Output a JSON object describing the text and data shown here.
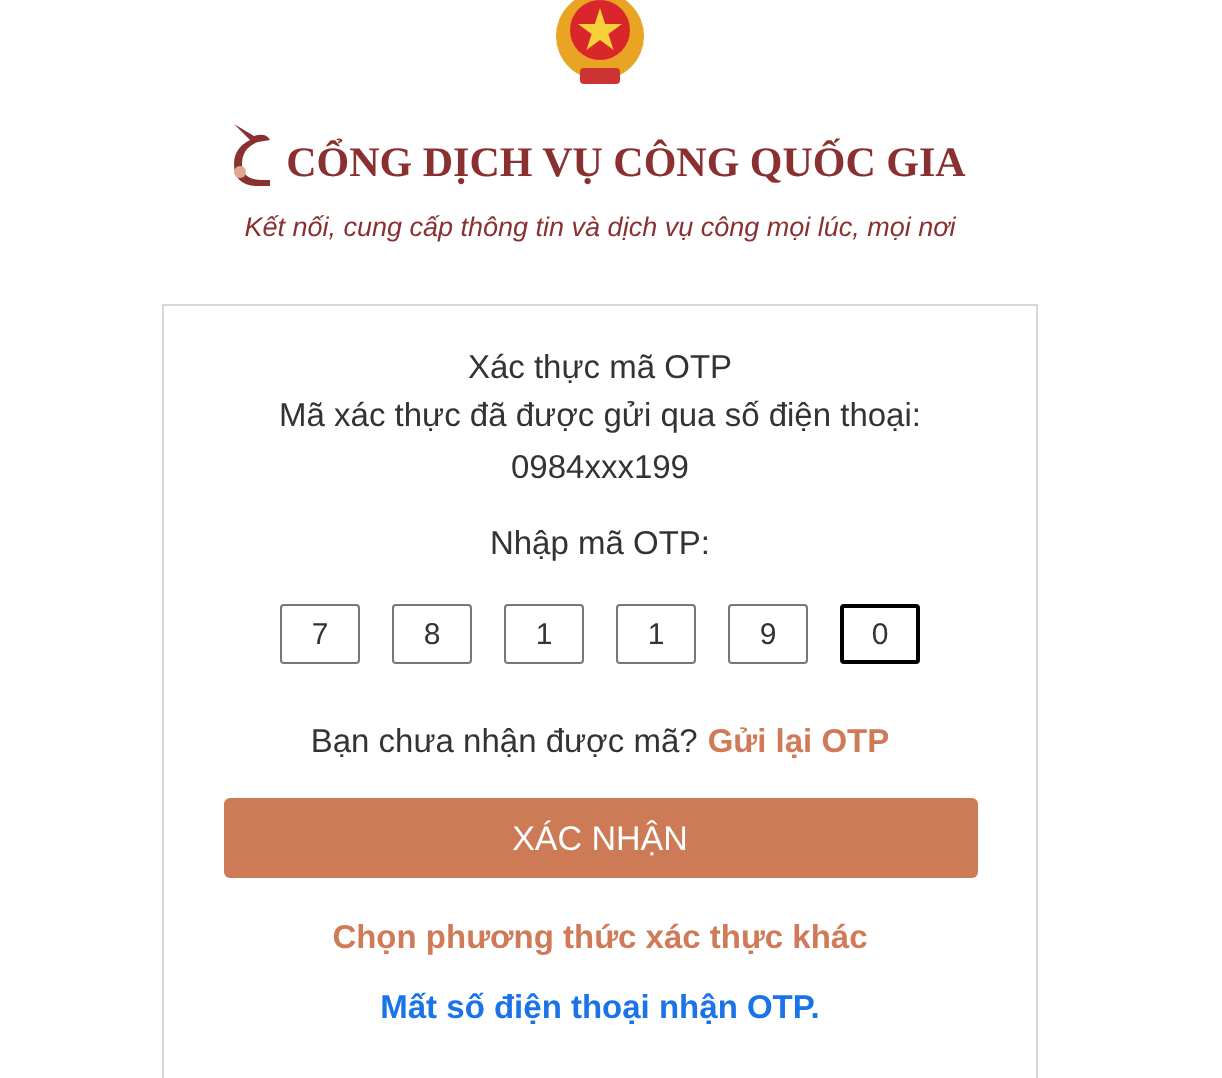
{
  "header": {
    "title": "CỔNG DỊCH VỤ CÔNG QUỐC GIA",
    "tagline": "Kết nối, cung cấp thông tin và dịch vụ công mọi lúc, mọi nơi"
  },
  "card": {
    "heading": "Xác thực mã OTP",
    "message": "Mã xác thực đã được gửi qua số điện thoại:",
    "phone": "0984xxx199",
    "otp_label": "Nhập mã OTP:",
    "otp_digits": [
      {
        "value": "7",
        "focused": false
      },
      {
        "value": "8",
        "focused": false
      },
      {
        "value": "1",
        "focused": false
      },
      {
        "value": "1",
        "focused": false
      },
      {
        "value": "9",
        "focused": false
      },
      {
        "value": "0",
        "focused": true
      }
    ],
    "resend_prompt": "Bạn chưa nhận được mã?",
    "resend_link": "Gửi lại OTP",
    "confirm_button": "XÁC NHẬN",
    "other_method_link": "Chọn phương thức xác thực khác",
    "lost_phone_link": "Mất số điện thoại nhận OTP."
  }
}
